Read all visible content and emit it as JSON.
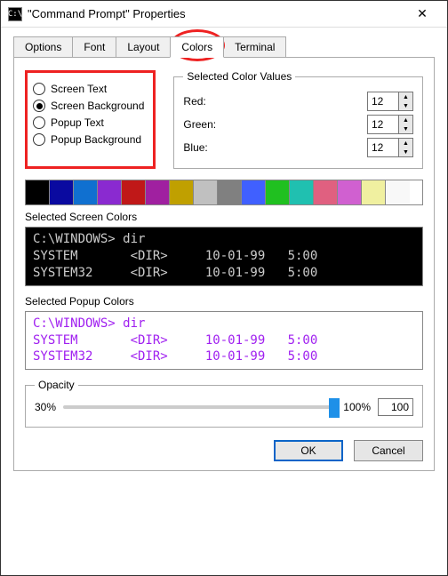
{
  "title": "\"Command Prompt\" Properties",
  "tabs": [
    "Options",
    "Font",
    "Layout",
    "Colors",
    "Terminal"
  ],
  "radios": {
    "screen_text": "Screen Text",
    "screen_bg": "Screen Background",
    "popup_text": "Popup Text",
    "popup_bg": "Popup Background"
  },
  "selected_radio": "screen_bg",
  "scv": {
    "legend": "Selected Color Values",
    "red_label": "Red:",
    "green_label": "Green:",
    "blue_label": "Blue:",
    "red": "12",
    "green": "12",
    "blue": "12"
  },
  "palette": [
    "#000000",
    "#0a0aa0",
    "#1070d0",
    "#8a2ad0",
    "#c01818",
    "#a020a0",
    "#c0a000",
    "#c0c0c0",
    "#808080",
    "#4060ff",
    "#20c020",
    "#20c0b0",
    "#e06080",
    "#d060d0",
    "#f0f0a0",
    "#f8f8f8"
  ],
  "screen_label": "Selected Screen Colors",
  "popup_label": "Selected Popup Colors",
  "preview": {
    "line1": "C:\\WINDOWS> dir",
    "line2": "SYSTEM       <DIR>     10-01-99   5:00",
    "line3": "SYSTEM32     <DIR>     10-01-99   5:00"
  },
  "opacity": {
    "legend": "Opacity",
    "min_label": "30%",
    "max_label": "100%",
    "value": "100"
  },
  "buttons": {
    "ok": "OK",
    "cancel": "Cancel"
  }
}
